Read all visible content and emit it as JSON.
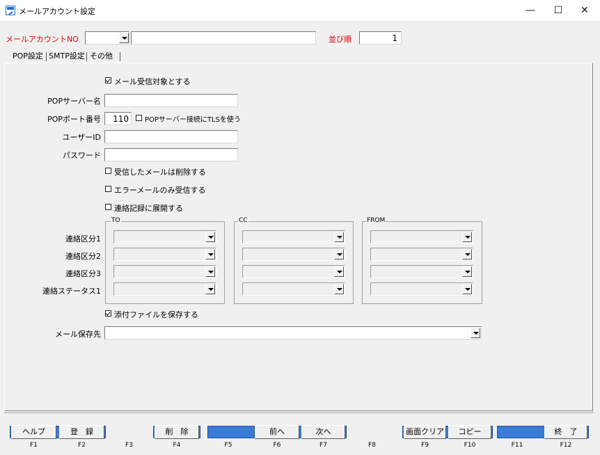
{
  "window": {
    "title": "メールアカウント設定",
    "minimize": "—",
    "maximize": "☐",
    "close": "✕"
  },
  "header": {
    "account_no_label": "メールアカウントNO",
    "account_no_value": "",
    "account_name_value": "",
    "order_label": "並び順",
    "order_value": "1"
  },
  "tabs": [
    {
      "label": "POP設定"
    },
    {
      "label": "SMTP設定"
    },
    {
      "label": "その他"
    }
  ],
  "pop": {
    "receive_target_label": "メール受信対象とする",
    "receive_target_checked": true,
    "server_label": "POPサーバー名",
    "server_value": "",
    "port_label": "POPポート番号",
    "port_value": "110",
    "tls_label": "POPサーバー接続にTLSを使う",
    "tls_checked": false,
    "user_label": "ユーザーID",
    "user_value": "",
    "password_label": "パスワード",
    "password_value": "",
    "delete_received_label": "受信したメールは削除する",
    "error_only_label": "エラーメールのみ受信する",
    "expand_contact_label": "連絡記録に展開する",
    "groups": {
      "to": "TO",
      "cc": "CC",
      "from": "FROM"
    },
    "rows": [
      {
        "label": "連絡区分1"
      },
      {
        "label": "連絡区分2"
      },
      {
        "label": "連絡区分3"
      },
      {
        "label": "連絡ステータス1"
      }
    ],
    "save_attachment_label": "添付ファイルを保存する",
    "save_attachment_checked": true,
    "mail_dest_label": "メール保存先",
    "mail_dest_value": ""
  },
  "function_keys": [
    {
      "label": "ヘルプ",
      "key": "F1"
    },
    {
      "label": "登　録",
      "key": "F2"
    },
    {
      "label": "",
      "key": "F3"
    },
    {
      "label": "削　除",
      "key": "F4"
    },
    {
      "label": "",
      "key": "F5"
    },
    {
      "label": "前へ",
      "key": "F6"
    },
    {
      "label": "次へ",
      "key": "F7"
    },
    {
      "label": "",
      "key": "F8"
    },
    {
      "label": "画面クリア",
      "key": "F9"
    },
    {
      "label": "コピー",
      "key": "F10"
    },
    {
      "label": "",
      "key": "F11"
    },
    {
      "label": "終　了",
      "key": "F12"
    }
  ],
  "colors": {
    "accent_label": "#e00000",
    "function_bar": "#3a7bd5"
  }
}
